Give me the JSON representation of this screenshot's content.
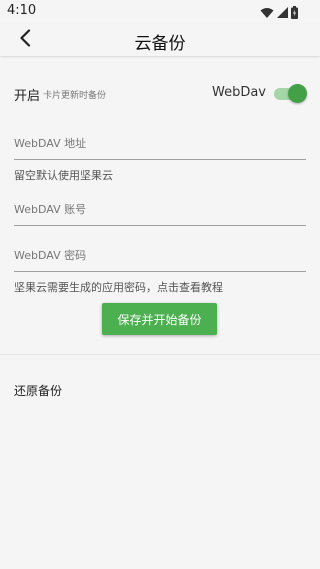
{
  "status_bar": {
    "time": "4:10",
    "icons": [
      "wifi-icon",
      "signal-icon",
      "battery-icon"
    ]
  },
  "toolbar": {
    "back_icon": "chevron-left-icon",
    "title": "云备份"
  },
  "enable_row": {
    "label": "开启",
    "hint": "卡片更新时备份",
    "service_label": "WebDav",
    "switch_on": true,
    "switch_color": "#43a047"
  },
  "form": {
    "address_placeholder": "WebDAV 地址",
    "address_hint": "留空默认使用坚果云",
    "account_placeholder": "WebDAV 账号",
    "password_placeholder": "WebDAV 密码",
    "password_hint": "坚果云需要生成的应用密码，点击查看教程"
  },
  "save_button": {
    "label": "保存并开始备份",
    "color": "#4caf50"
  },
  "restore": {
    "label": "还原备份"
  }
}
